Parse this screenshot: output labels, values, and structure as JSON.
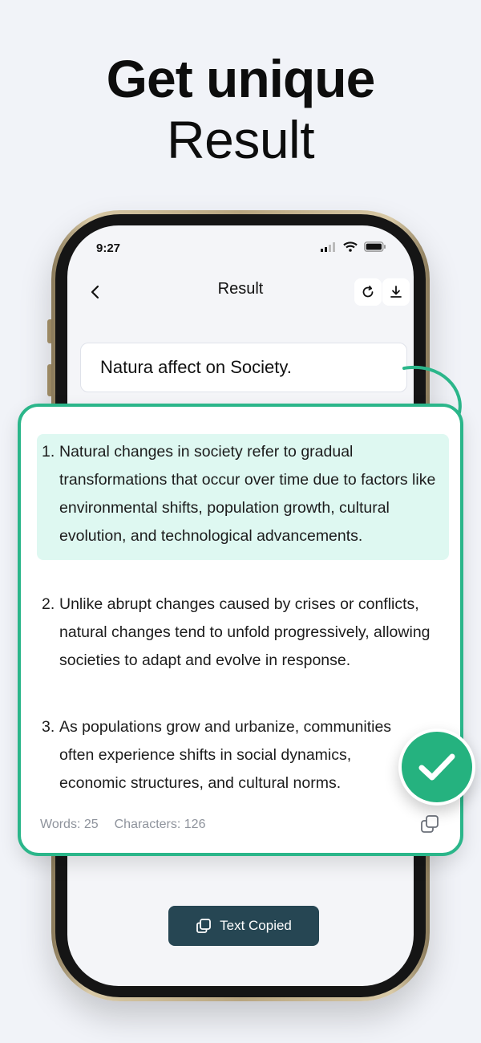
{
  "headline": {
    "line1": "Get unique",
    "line2": "Result"
  },
  "status_bar": {
    "time": "9:27"
  },
  "header": {
    "title": "Result"
  },
  "input": {
    "value": "Natura affect on Society."
  },
  "result_items": [
    {
      "num": "1.",
      "text": "Natural changes in society refer to gradual transformations that occur over time due to factors like environmental shifts, population growth, cultural evolution, and technological advancements."
    },
    {
      "num": "2.",
      "text": "Unlike abrupt changes caused by crises or conflicts, natural changes tend to unfold progressively, allowing societies to adapt and evolve in response."
    },
    {
      "num": "3.",
      "text": "As populations grow and urbanize, communities often experience shifts in social dynamics, economic structures, and cultural norms."
    }
  ],
  "footer": {
    "words": "Words: 25",
    "characters": "Characters: 126"
  },
  "copied_button": {
    "label": "Text Copied"
  },
  "colors": {
    "accent": "#2bb68a",
    "highlight": "#def8f1",
    "button_dark": "#264653"
  },
  "icons": {
    "back": "chevron-left-icon",
    "refresh": "refresh-icon",
    "download": "download-icon",
    "copy": "copy-icon",
    "check": "check-icon",
    "arrow": "curved-arrow-icon"
  }
}
